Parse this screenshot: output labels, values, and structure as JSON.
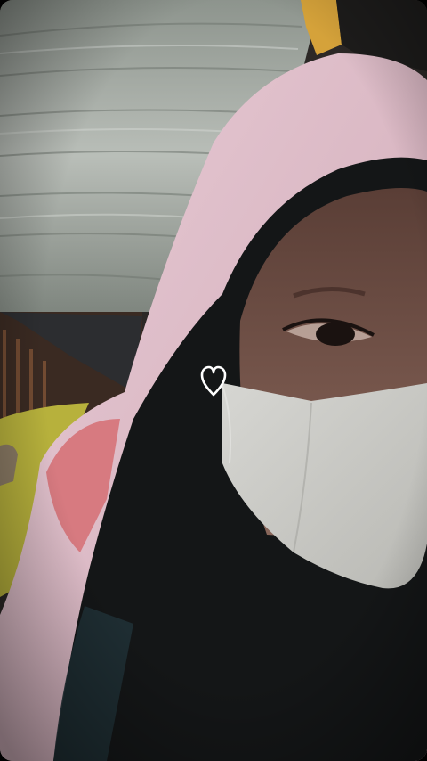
{
  "photo": {
    "description_icon": "selfie-photo",
    "colors": {
      "hood_pink": "#e6c8d2",
      "mask_grey": "#cfcfcb",
      "scarf_dark": "#151718",
      "canopy": "#b7bcb7",
      "skin": "#7a5a50",
      "background_dark": "#2c2826",
      "heart_outline": "#ffffff"
    }
  },
  "sticker": {
    "icon": "heart-outline-icon"
  }
}
